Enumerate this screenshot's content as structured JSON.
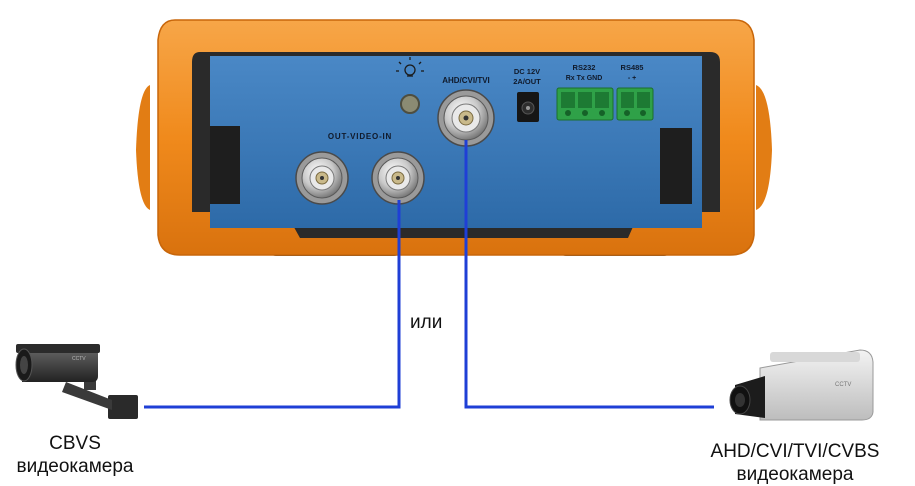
{
  "device": {
    "panel_labels": {
      "out_video_in": "OUT-VIDEO-IN",
      "ahd_cvi_tvi": "AHD/CVI/TVI",
      "dc_line1": "DC 12V",
      "dc_line2": "2A/OUT",
      "rs232": "RS232",
      "rs232_pins": "Rx Tx GND",
      "rs485": "RS485",
      "rs485_pins": "-   +"
    }
  },
  "connector_word": "или",
  "camera_left": {
    "line1": "CBVS",
    "line2": "видеокамера"
  },
  "camera_right": {
    "line1": "AHD/CVI/TVI/CVBS",
    "line2": "видеокамера"
  },
  "colors": {
    "housing_orange": "#f08a1c",
    "panel_blue": "#3b78b8",
    "cable_blue": "#1f3fd6"
  }
}
